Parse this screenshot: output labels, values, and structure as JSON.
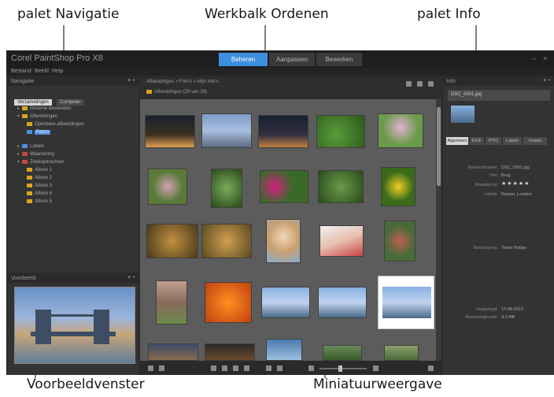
{
  "callouts": {
    "nav_palette": "palet Navigatie",
    "toolbar": "Werkbalk Ordenen",
    "info_palette": "palet Info",
    "preview": "Voorbeeldvenster",
    "thumbnails": "Miniatuurweergave"
  },
  "app": {
    "title": "Corel PaintShop Pro X8",
    "tabs": [
      {
        "label": "Beheren",
        "active": true
      },
      {
        "label": "Aanpassen",
        "active": false
      },
      {
        "label": "Bewerken",
        "active": false
      }
    ],
    "menu": [
      "Bestand",
      "Beeld",
      "Help"
    ]
  },
  "navigation": {
    "header": "Navigatie",
    "tabs": [
      "Verzamelingen",
      "Computer"
    ],
    "tree": [
      {
        "label": "Recente bestanden",
        "icon": "folder-icon"
      },
      {
        "label": "Afbeeldingen",
        "icon": "folder-icon"
      },
      {
        "label": "Openbare afbeeldingen",
        "icon": "folder-icon"
      },
      {
        "label": "Foto's",
        "icon": "folder-blue-icon"
      },
      {
        "label": "Labels",
        "icon": "label-icon"
      },
      {
        "label": "Waardering",
        "icon": "star-icon"
      },
      {
        "label": "Zoekopdrachten",
        "icon": "search-folder-icon"
      },
      {
        "label": "Album 1",
        "icon": "folder-icon"
      },
      {
        "label": "Album 2",
        "icon": "folder-icon"
      },
      {
        "label": "Album 3",
        "icon": "folder-icon"
      },
      {
        "label": "Album 4",
        "icon": "folder-icon"
      },
      {
        "label": "Album 5",
        "icon": "folder-icon"
      }
    ]
  },
  "preview_panel": {
    "header": "Voorbeeld"
  },
  "organizer": {
    "breadcrumb": "Afbeeldingen > Foto's > Mijn foto's",
    "path": "Afbeeldingen (28 van 28)"
  },
  "info": {
    "header": "Info",
    "file_name": "DSC_0001.jpg",
    "tabs": [
      "Algemeen",
      "EXIF",
      "IPTC",
      "Labels",
      "Details"
    ],
    "rows": [
      {
        "label": "Bestandsnaam:",
        "value": "DSC_0001.jpg"
      },
      {
        "label": "Titel:",
        "value": "Brug"
      },
      {
        "label": "Waardering:",
        "value": "★★★★★"
      },
      {
        "label": "Labels:",
        "value": "Reizen, Londen"
      },
      {
        "label": "Beschrijving:",
        "value": "Tower Bridge"
      }
    ],
    "footer_rows": [
      {
        "label": "Vastgelegd:",
        "value": "12-08-2015"
      },
      {
        "label": "Bestandsgrootte:",
        "value": "4,2 MB"
      }
    ]
  },
  "colors": {
    "accent": "#3d8fe0",
    "app_bg": "#2b2b2b",
    "panel_bg": "#333333",
    "callout_arrow": "#808080"
  }
}
